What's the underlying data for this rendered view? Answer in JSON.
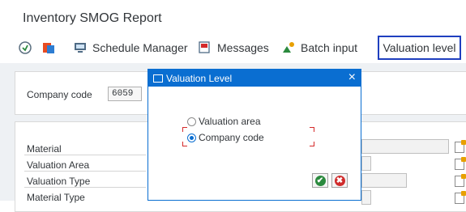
{
  "window": {
    "title": "Inventory SMOG Report"
  },
  "toolbar": {
    "schedule_manager": "Schedule Manager",
    "messages": "Messages",
    "batch_input": "Batch input",
    "valuation_level": "Valuation level"
  },
  "form": {
    "company_code_label": "Company code",
    "company_code_value": "6059",
    "material_label": "Material",
    "valuation_area_label": "Valuation Area",
    "valuation_type_label": "Valuation Type",
    "material_type_label": "Material Type"
  },
  "dialog": {
    "title": "Valuation Level",
    "close_symbol": "×",
    "options": [
      {
        "label": "Valuation area",
        "selected": false
      },
      {
        "label": "Company code",
        "selected": true
      }
    ],
    "ok_symbol": "✔",
    "cancel_symbol": "✖"
  },
  "colors": {
    "accent": "#0a6ed1",
    "focus": "#1f3fbf",
    "ok": "#2b8a3e",
    "cancel": "#d02c2c"
  }
}
